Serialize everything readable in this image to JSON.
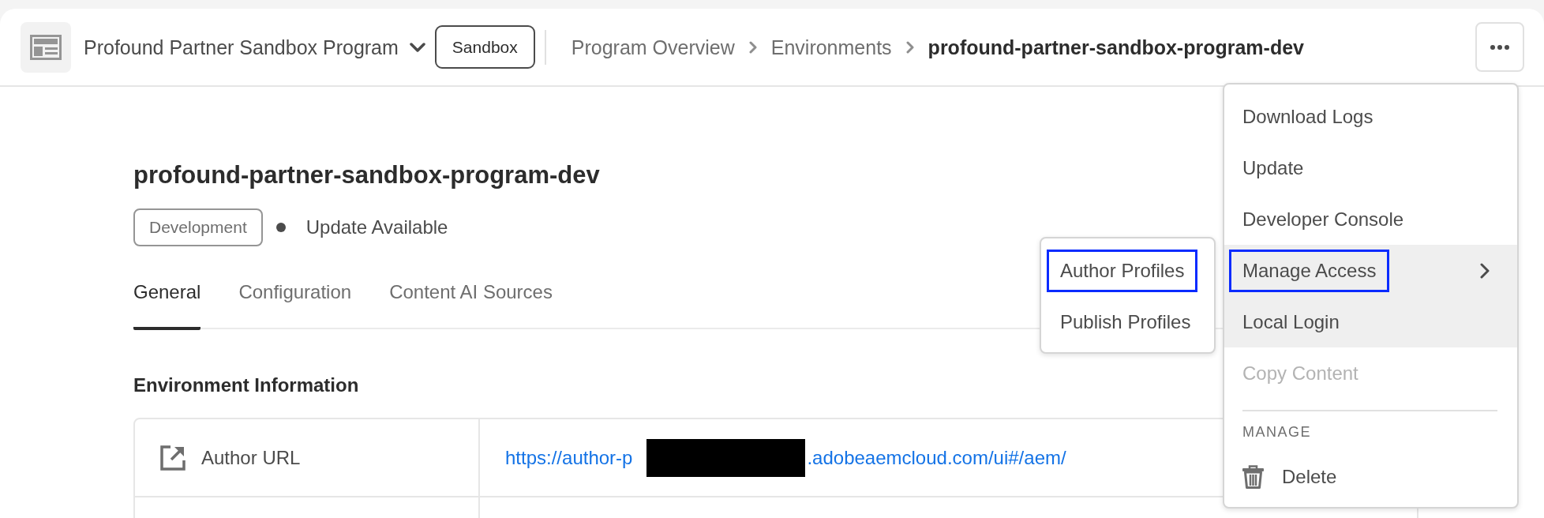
{
  "header": {
    "program_name": "Profound Partner Sandbox Program",
    "program_tag": "Sandbox",
    "breadcrumbs": [
      {
        "label": "Program Overview",
        "current": false
      },
      {
        "label": "Environments",
        "current": false
      },
      {
        "label": "profound-partner-sandbox-program-dev",
        "current": true
      }
    ]
  },
  "environment": {
    "title": "profound-partner-sandbox-program-dev",
    "type_tag": "Development",
    "status": "Update Available"
  },
  "tabs": [
    {
      "label": "General",
      "selected": true
    },
    {
      "label": "Configuration",
      "selected": false
    },
    {
      "label": "Content AI Sources",
      "selected": false
    }
  ],
  "section_title": "Environment Information",
  "info_table": {
    "rows": [
      {
        "label": "Author URL",
        "url_visible_start": "https://author-p",
        "url_visible_end": ".adobeaemcloud.com/ui#/aem/"
      }
    ]
  },
  "actions_menu": {
    "groups": [
      {
        "items": [
          {
            "kind": "plain",
            "label": "Download Logs",
            "highlighted": false,
            "disabled": false,
            "outlined": false
          },
          {
            "kind": "plain",
            "label": "Update",
            "highlighted": false,
            "disabled": false,
            "outlined": false
          },
          {
            "kind": "plain",
            "label": "Developer Console",
            "highlighted": false,
            "disabled": false,
            "outlined": false
          },
          {
            "kind": "submenu",
            "label": "Manage Access",
            "highlighted": true,
            "disabled": false,
            "outlined": true,
            "submenu": [
              {
                "label": "Author Profiles",
                "outlined": true
              },
              {
                "label": "Publish Profiles",
                "outlined": false
              }
            ]
          },
          {
            "kind": "plain",
            "label": "Local Login",
            "highlighted": true,
            "disabled": false,
            "outlined": false
          },
          {
            "kind": "plain",
            "label": "Copy Content",
            "highlighted": false,
            "disabled": true,
            "outlined": false
          }
        ]
      },
      {
        "heading": "MANAGE",
        "items": [
          {
            "kind": "trash",
            "label": "Delete",
            "highlighted": false,
            "disabled": false,
            "outlined": false
          }
        ]
      }
    ]
  }
}
